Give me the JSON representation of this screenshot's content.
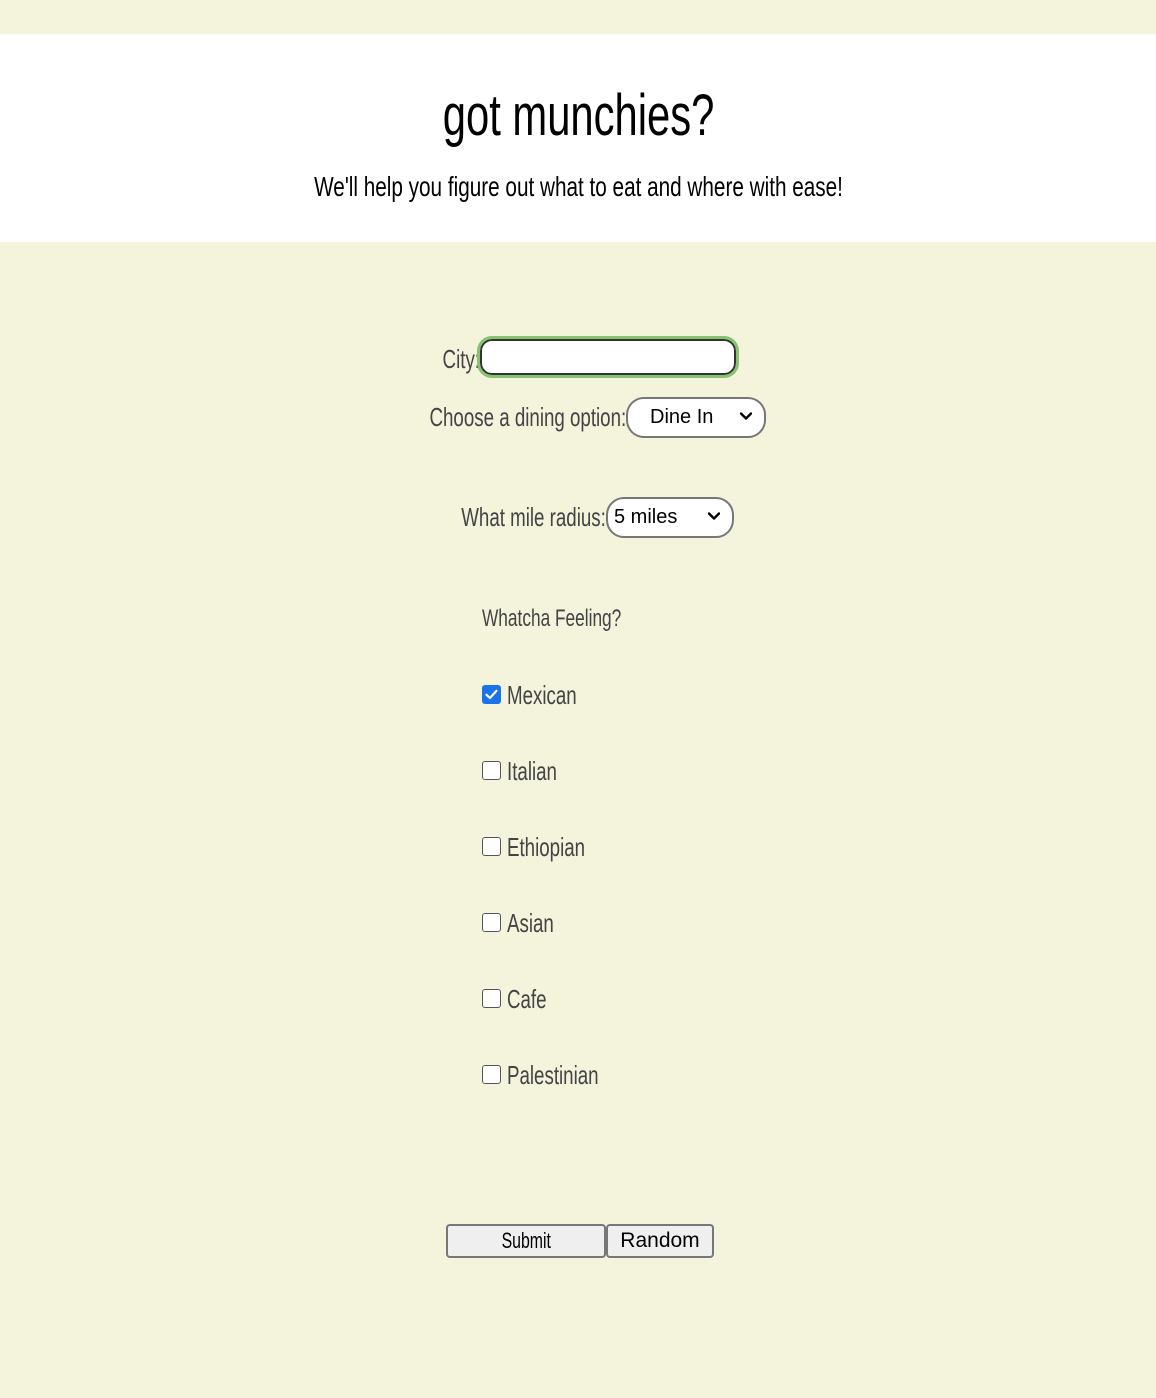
{
  "header": {
    "title": "got munchies?",
    "subtitle": "We'll help you figure out what to eat and where with ease!"
  },
  "form": {
    "city_label": "City:",
    "city_value": "",
    "dining_label": "Choose a dining option:",
    "dining_selected": "Dine In",
    "radius_label": "What mile radius:",
    "radius_selected": "5 miles",
    "feeling_heading": "Whatcha Feeling?",
    "cuisines": [
      {
        "label": "Mexican",
        "checked": true
      },
      {
        "label": "Italian",
        "checked": false
      },
      {
        "label": "Ethiopian",
        "checked": false
      },
      {
        "label": "Asian",
        "checked": false
      },
      {
        "label": "Cafe",
        "checked": false
      },
      {
        "label": "Palestinian",
        "checked": false
      }
    ],
    "submit_label": "Submit",
    "random_label": "Random"
  },
  "colors": {
    "page_background": "#f4f3dc",
    "header_background": "#ffffff",
    "input_focus": "#86c26f",
    "checkbox_checked": "#1a73e8"
  },
  "icons": {
    "select_arrow": "chevron-down-icon",
    "checkbox_check": "check-icon"
  }
}
